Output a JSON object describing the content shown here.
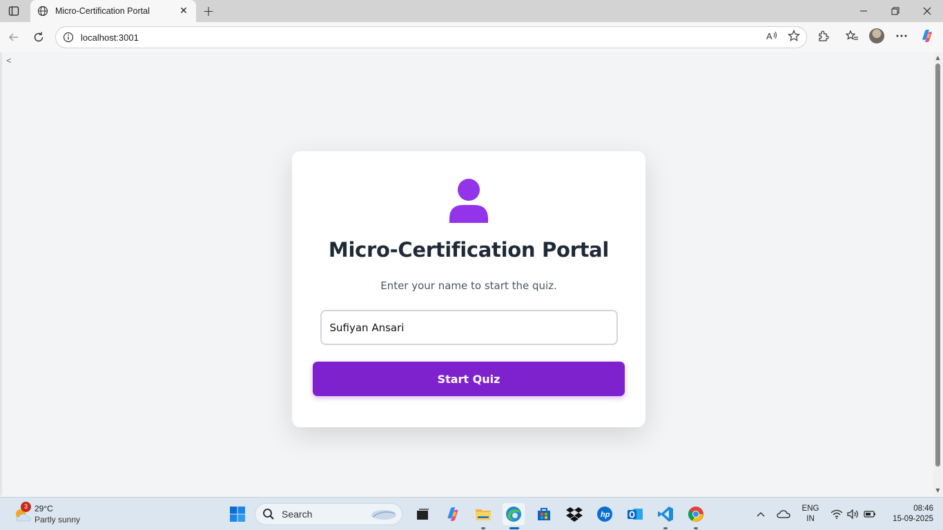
{
  "browser": {
    "tab_title": "Micro-Certification Portal",
    "url": "localhost:3001"
  },
  "page": {
    "back_link": "<",
    "title": "Micro-Certification Portal",
    "subtitle": "Enter your name to start the quiz.",
    "name_input_value": "Sufiyan Ansari",
    "start_button_label": "Start Quiz",
    "accent_color": "#7e22ce",
    "icon_color": "#9333ea"
  },
  "taskbar": {
    "weather_badge": "3",
    "weather_temp": "29°C",
    "weather_condition": "Partly sunny",
    "search_label": "Search",
    "language": "ENG",
    "region": "IN",
    "time": "08:46",
    "date": "15-09-2025"
  }
}
